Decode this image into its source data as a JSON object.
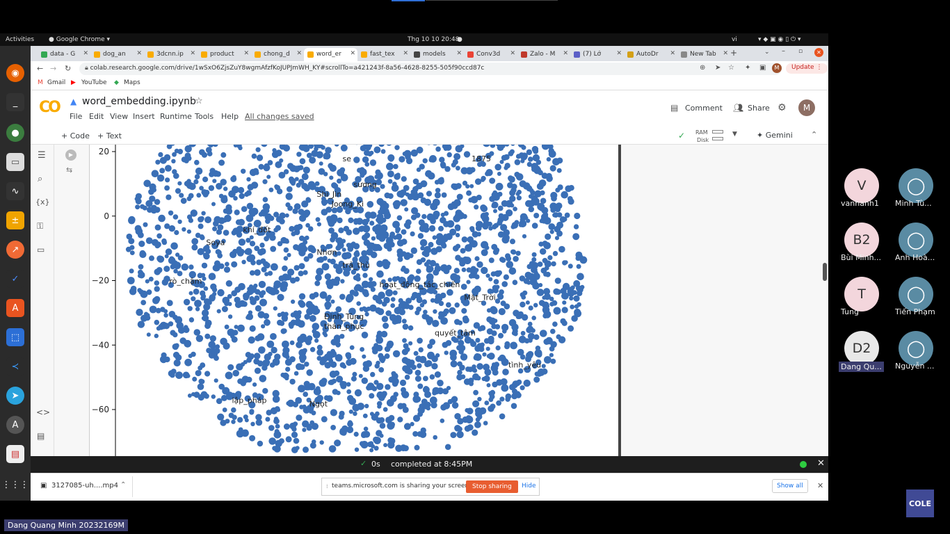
{
  "gnome": {
    "activities": "Activities",
    "app": "Google Chrome",
    "clock": "Thg 10 10  20:48",
    "lang": "vi"
  },
  "tabs": [
    "data - G",
    "dog_an",
    "3dcnn.ip",
    "product",
    "chong_d",
    "word_er",
    "fast_tex",
    "models",
    "Conv3d",
    "Zalo - M",
    "(7) Lớ",
    "AutoDr",
    "New Tab"
  ],
  "address": {
    "url": "colab.research.google.com/drive/1wSxO6ZjsZuY8wgmAfzfKoJUPJmWH_KY#scrollTo=a421243f-8a56-4628-8255-505f90ccd87c",
    "update": "Update"
  },
  "bookmarks": {
    "gmail": "Gmail",
    "youtube": "YouTube",
    "maps": "Maps"
  },
  "colab": {
    "logo": "CO",
    "title": "word_embedding.ipynb",
    "menus": [
      "File",
      "Edit",
      "View",
      "Insert",
      "Runtime",
      "Tools",
      "Help"
    ],
    "saved": "All changes saved",
    "comment": "Comment",
    "share": "Share",
    "user_initial": "M",
    "add_code": "+ Code",
    "add_text": "+ Text",
    "ram": "RAM",
    "disk": "Disk",
    "gemini": "Gemini"
  },
  "chart_data": {
    "type": "scatter",
    "title": "",
    "xlabel": "",
    "ylabel": "",
    "ylim": [
      -72,
      22
    ],
    "yticks": [
      "20",
      "0",
      "−20",
      "−40",
      "−60"
    ],
    "color": "#3a6fb6",
    "annotations": [
      {
        "text": "se",
        "x": -5,
        "y": 17
      },
      {
        "text": "1875",
        "x": 30,
        "y": 17
      },
      {
        "text": "sương",
        "x": -2,
        "y": 9
      },
      {
        "text": "Shi_Jin",
        "x": -12,
        "y": 6
      },
      {
        "text": "Joong_Ki",
        "x": -8,
        "y": 3
      },
      {
        "text": "khí_đốt",
        "x": -32,
        "y": -5
      },
      {
        "text": "Soya",
        "x": -42,
        "y": -9
      },
      {
        "text": "Nhơn",
        "x": -12,
        "y": -12
      },
      {
        "text": "trả_thù",
        "x": -5,
        "y": -16
      },
      {
        "text": "rò_chậm",
        "x": -52,
        "y": -21
      },
      {
        "text": "hoạt_động_tác_chiến",
        "x": 5,
        "y": -22
      },
      {
        "text": "Mặt_Trời",
        "x": 28,
        "y": -26
      },
      {
        "text": "Đinh_Tùng",
        "x": -10,
        "y": -32
      },
      {
        "text": "thán_phục",
        "x": -10,
        "y": -35
      },
      {
        "text": "quyết_tâm",
        "x": 20,
        "y": -37
      },
      {
        "text": "tình_yêu",
        "x": 40,
        "y": -47
      },
      {
        "text": "lập_pháp",
        "x": -35,
        "y": -58
      },
      {
        "text": "Ngọt",
        "x": -14,
        "y": -59
      }
    ]
  },
  "status": {
    "time": "0s",
    "text": "completed at 8:45PM"
  },
  "download": {
    "file": "3127085-uh....mp4",
    "share_msg": "teams.microsoft.com is sharing your screen.",
    "stop": "Stop sharing",
    "hide": "Hide",
    "show_all": "Show all"
  },
  "participants": [
    {
      "initials": "V",
      "name": "vanhanh1",
      "color": "#f3d6dc"
    },
    {
      "initials": "",
      "name": "Minh Tù...",
      "color": "#5a8ba3"
    },
    {
      "initials": "B2",
      "name": "Bùi Minh...",
      "color": "#f3d6dc"
    },
    {
      "initials": "",
      "name": "Anh Hoà...",
      "color": "#5a8ba3"
    },
    {
      "initials": "T",
      "name": "Tung",
      "color": "#f3d6dc"
    },
    {
      "initials": "",
      "name": "Tiến Phạm",
      "color": "#5a8ba3"
    },
    {
      "initials": "D2",
      "name": "Dang Qu...",
      "color": "#e8e8e8"
    },
    {
      "initials": "",
      "name": "Nguyễn ...",
      "color": "#5a8ba3"
    }
  ],
  "presenter": "Dang Quang Minh 20232169M",
  "corner_logo": "COLE"
}
